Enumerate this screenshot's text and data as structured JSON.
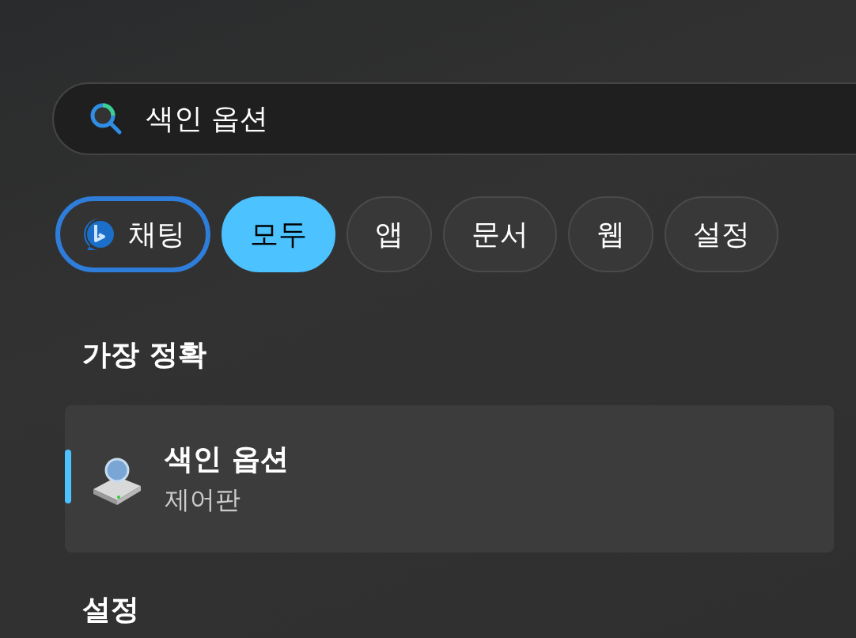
{
  "search": {
    "value": "색인 옵션"
  },
  "filters": [
    {
      "kind": "chat",
      "label": "채팅",
      "selected": false
    },
    {
      "kind": "filter",
      "label": "모두",
      "selected": true
    },
    {
      "kind": "filter",
      "label": "앱",
      "selected": false
    },
    {
      "kind": "filter",
      "label": "문서",
      "selected": false
    },
    {
      "kind": "filter",
      "label": "웹",
      "selected": false
    },
    {
      "kind": "filter",
      "label": "설정",
      "selected": false
    }
  ],
  "best_match": {
    "heading": "가장 정확",
    "results": [
      {
        "title": "색인 옵션",
        "subtitle": "제어판",
        "selected": true
      }
    ]
  },
  "next_section": {
    "heading": "설정"
  }
}
